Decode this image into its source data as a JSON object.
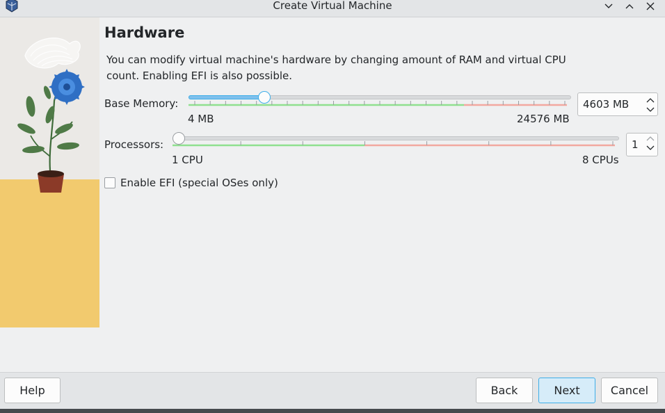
{
  "window": {
    "title": "Create Virtual Machine",
    "icons": [
      "virtualbox-icon",
      "minimize-icon",
      "maximize-icon",
      "close-icon"
    ]
  },
  "page": {
    "title": "Hardware",
    "description": "You can modify virtual machine's hardware by changing amount of RAM and virtual CPU count. Enabling EFI is also possible."
  },
  "memory": {
    "label": "Base Memory:",
    "min_label": "4 MB",
    "max_label": "24576 MB",
    "value": "4603 MB",
    "value_mb": 4603,
    "min_mb": 4,
    "max_mb": 24576
  },
  "processors": {
    "label": "Processors:",
    "min_label": "1 CPU",
    "max_label": "8 CPUs",
    "value": "1",
    "value_num": 1,
    "min": 1,
    "max": 8
  },
  "efi": {
    "label": "Enable EFI (special OSes only)",
    "checked": false
  },
  "buttons": {
    "help": "Help",
    "back": "Back",
    "next": "Next",
    "cancel": "Cancel"
  },
  "colors": {
    "accent": "#3daee9",
    "safe_range": "#8fe08f",
    "warn_range": "#f2a8a0"
  }
}
